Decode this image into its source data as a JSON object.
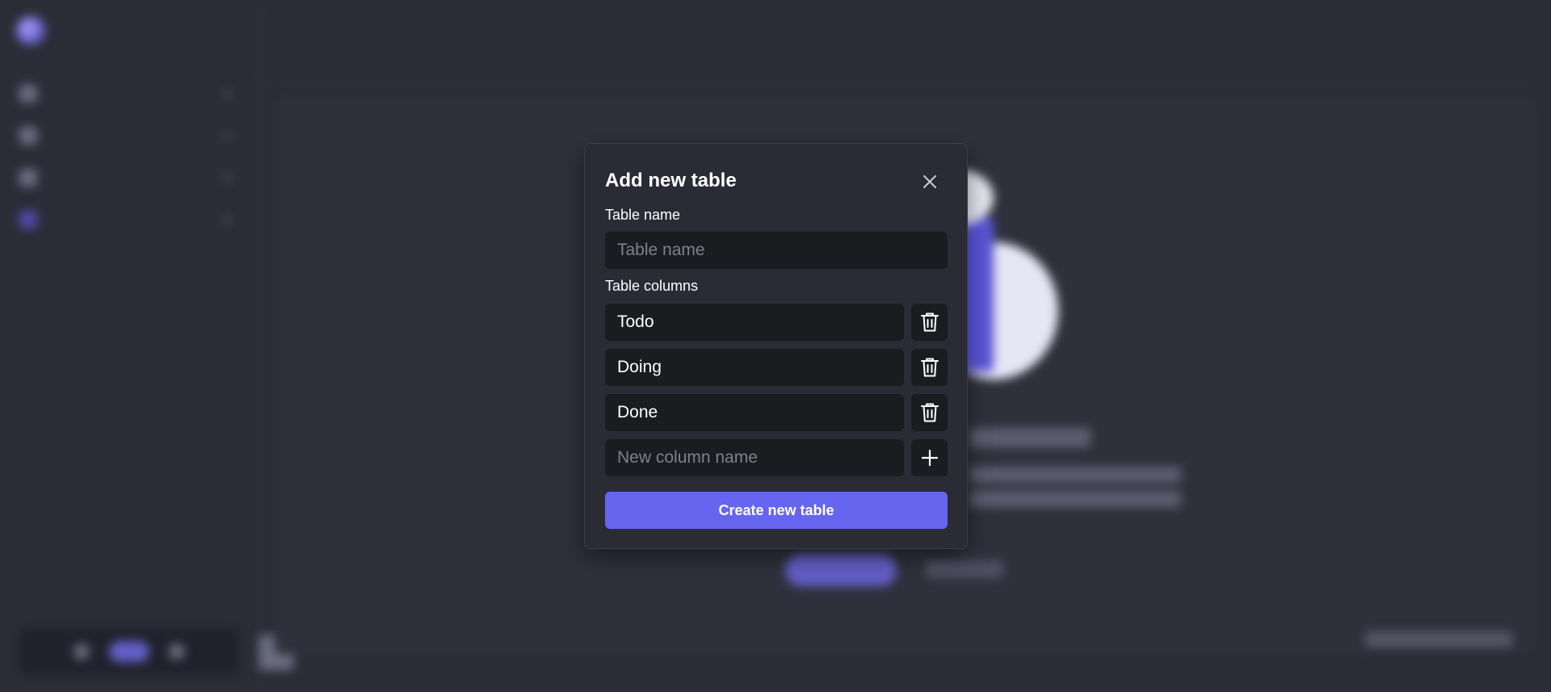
{
  "modal": {
    "title": "Add new table",
    "close_icon": "close-icon",
    "table_name_label": "Table name",
    "table_name_value": "",
    "table_name_placeholder": "Table name",
    "columns_label": "Table columns",
    "columns": [
      {
        "value": "Todo",
        "delete_icon": "trash-icon"
      },
      {
        "value": "Doing",
        "delete_icon": "trash-icon"
      },
      {
        "value": "Done",
        "delete_icon": "trash-icon"
      }
    ],
    "new_column_value": "",
    "new_column_placeholder": "New column name",
    "add_icon": "plus-icon",
    "create_button_label": "Create new table"
  },
  "colors": {
    "accent": "#6565ef",
    "modal_bg": "#2b2b36",
    "input_bg": "#1a1c1f",
    "page_bg": "#2b2c37"
  }
}
